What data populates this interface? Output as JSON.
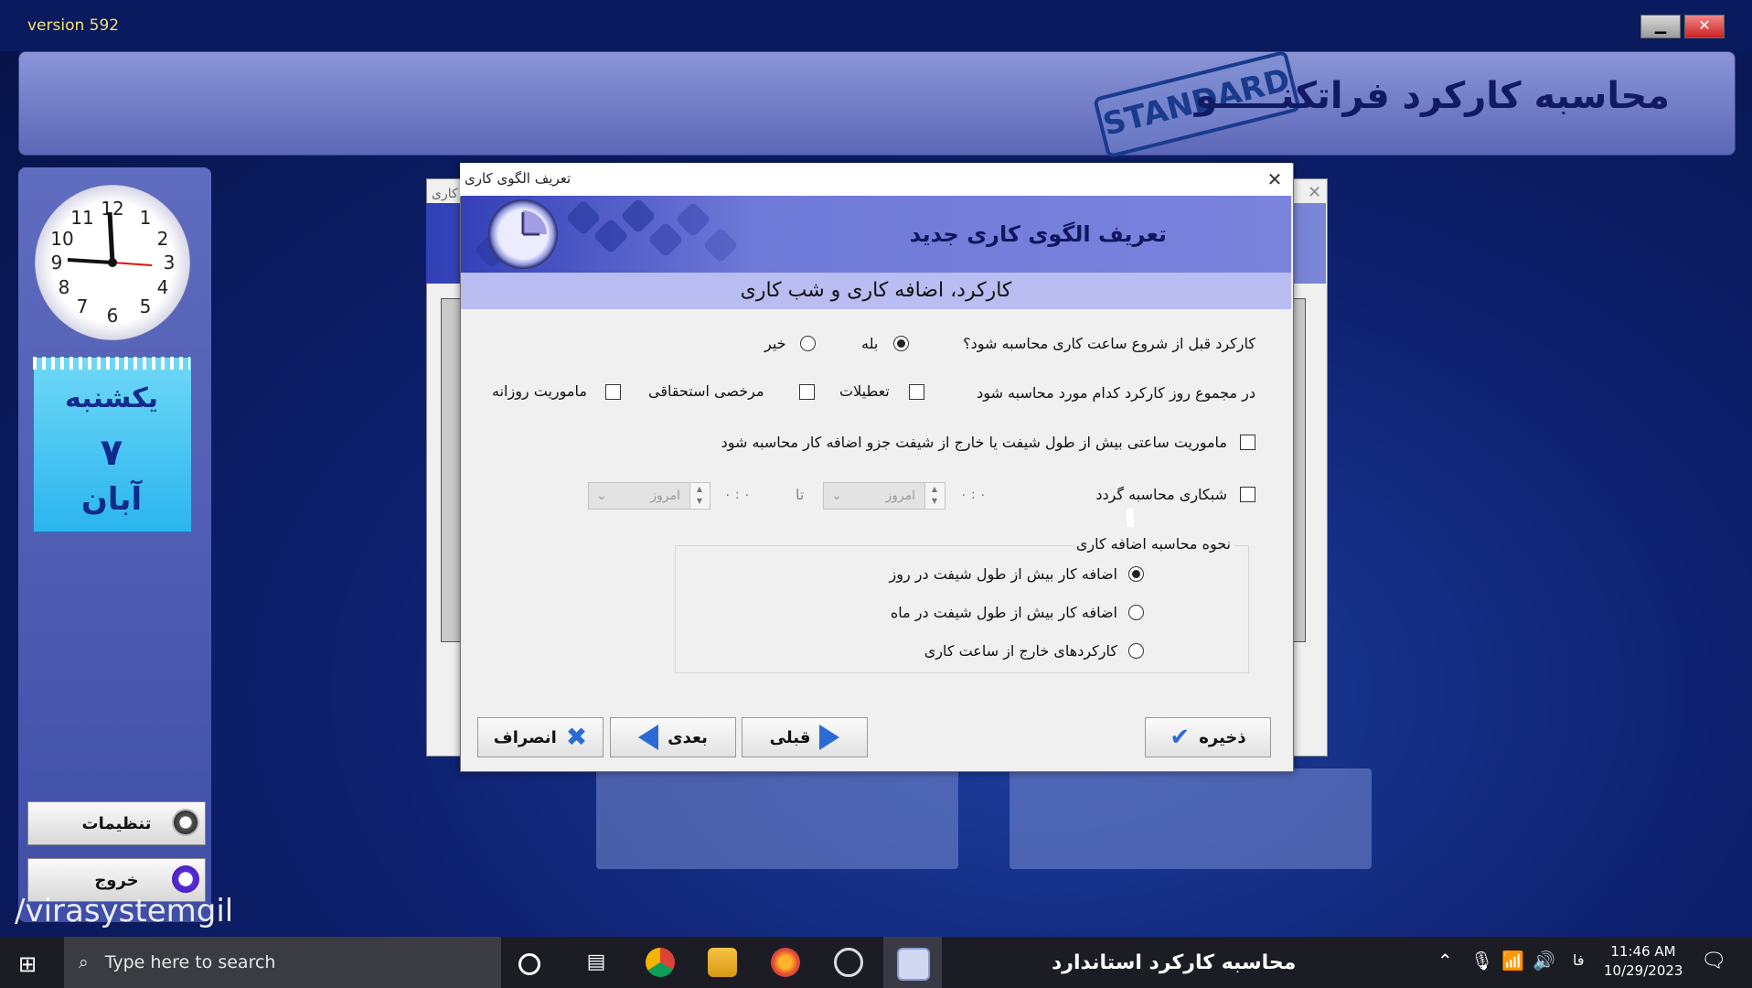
{
  "app": {
    "version": "version 592",
    "banner_title": "محاسبه کارکرد فراتکنـــــو",
    "stamp": "STANDARD"
  },
  "window_controls": {
    "minimize": "▁",
    "close": "✕"
  },
  "calendar": {
    "weekday": "یکشنبه",
    "day": "۷",
    "month": "آبان"
  },
  "side_buttons": {
    "settings": "تنظیمات",
    "exit": "خروج"
  },
  "watermark": "/virasystemgil",
  "background_dialog": {
    "title": "کاری"
  },
  "dialog": {
    "window_title": "تعریف الگوی کاری",
    "close": "✕",
    "header_title": "تعریف الگوی کاری جدید",
    "subheader": "کارکرد، اضافه کاری و شب کاری",
    "q1": {
      "label": "کارکرد قبل از شروع ساعت کاری محاسبه شود؟",
      "yes": "بله",
      "no": "خیر",
      "selected": "yes"
    },
    "q2": {
      "label": "در مجموع روز کارکرد کدام مورد محاسبه شود",
      "options": [
        {
          "label": "تعطیلات",
          "checked": false
        },
        {
          "label": "مرخصی استحقاقی",
          "checked": false
        },
        {
          "label": "ماموریت روزانه",
          "checked": false
        }
      ]
    },
    "q3": {
      "label": "ماموریت ساعتی بیش از طول شیفت یا خارج از شیفت جزو اضافه کار محاسبه شود",
      "checked": false
    },
    "q4": {
      "label": "شبکاری محاسبه گردد",
      "checked": false,
      "from_time": "۰  :  ۰",
      "from_day": "امروز",
      "to_label": "تا",
      "to_time": "۰  :  ۰",
      "to_day": "امروز"
    },
    "overtime_group": {
      "title": "نحوه محاسبه اضافه کاری",
      "options": [
        {
          "label": "اضافه کار بیش از طول شیفت در روز",
          "selected": true
        },
        {
          "label": "اضافه کار بیش از طول شیفت در ماه",
          "selected": false
        },
        {
          "label": "کارکردهای خارج از ساعت کاری",
          "selected": false
        }
      ]
    },
    "buttons": {
      "cancel": "انصراف",
      "next": "بعدی",
      "prev": "قبلی",
      "save": "ذخیره"
    }
  },
  "taskbar": {
    "search_placeholder": "Type here to search",
    "active_app_title": "محاسبه کارکرد استاندارد",
    "language": "فا",
    "time": "11:46 AM",
    "date": "10/29/2023"
  },
  "colors": {
    "accent": "#3440b8",
    "subheader": "#b9bdf1",
    "calendar": "#2bb5ee"
  }
}
